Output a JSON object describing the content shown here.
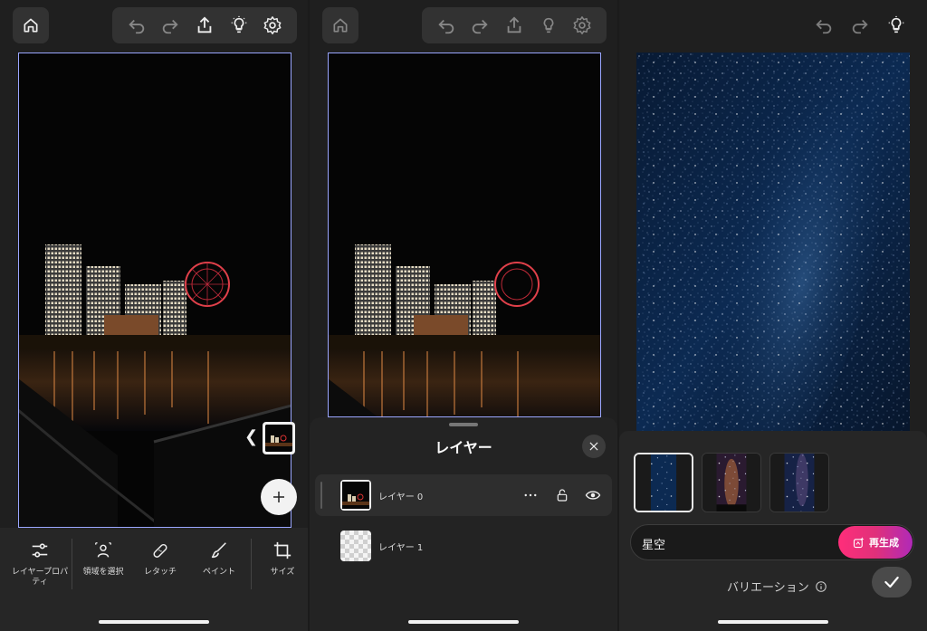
{
  "panel1": {
    "tools": [
      {
        "label": "レイヤープロパティ",
        "icon": "sliders-icon"
      },
      {
        "label": "領域を選択",
        "icon": "select-subject-icon"
      },
      {
        "label": "レタッチ",
        "icon": "bandage-icon"
      },
      {
        "label": "ペイント",
        "icon": "brush-icon"
      },
      {
        "label": "サイズ",
        "icon": "crop-icon"
      }
    ]
  },
  "panel2": {
    "sheet_title": "レイヤー",
    "layers": [
      {
        "name": "レイヤー 0"
      },
      {
        "name": "レイヤー 1"
      }
    ]
  },
  "panel3": {
    "prompt_value": "星空",
    "regenerate_label": "再生成",
    "variation_label": "バリエーション"
  },
  "colors": {
    "frame": "#9aa6ff",
    "regen_start": "#ff2e7a",
    "regen_end": "#b02ab8"
  }
}
